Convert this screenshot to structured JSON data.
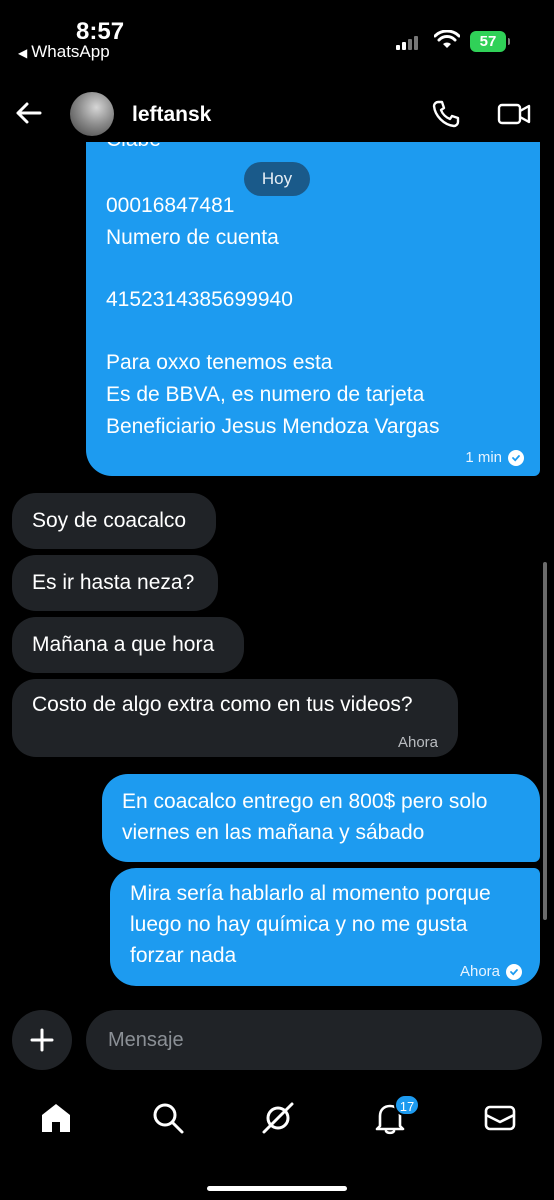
{
  "status": {
    "time": "8:57",
    "back_app": "WhatsApp",
    "battery": "57"
  },
  "header": {
    "contact_name": "leftansk"
  },
  "chat": {
    "cut_text": "Clabe",
    "date_label": "Hoy",
    "big_message_lines": [
      "00016847481",
      "Numero de cuenta",
      "4152314385699940",
      "Para oxxo tenemos esta",
      "Es de BBVA, es numero de tarjeta",
      "Beneficiario Jesus Mendoza Vargas"
    ],
    "big_message_time": "1 min",
    "incoming": [
      {
        "text": "Soy de coacalco"
      },
      {
        "text": "Es ir hasta neza?"
      },
      {
        "text": "Mañana a que hora"
      },
      {
        "text": "Costo de algo extra como en tus videos?",
        "time": "Ahora"
      }
    ],
    "outgoing": [
      {
        "lines": [
          "En coacalco entrego en 800$ pero solo",
          "viernes en las mañana y sábado"
        ]
      },
      {
        "lines": [
          "Mira sería hablarlo al momento porque",
          "luego no hay química y no me gusta",
          "forzar nada"
        ],
        "time": "Ahora"
      }
    ]
  },
  "composer": {
    "placeholder": "Mensaje"
  },
  "nav": {
    "notifications_badge": "17"
  },
  "colors": {
    "accent": "#1d9bf0",
    "incoming_bubble": "#202327",
    "background": "#000000"
  },
  "icons": [
    "back-arrow-icon",
    "phone-icon",
    "video-camera-icon",
    "plus-icon",
    "home-icon",
    "search-icon",
    "grok-icon",
    "bell-icon",
    "mail-icon"
  ]
}
